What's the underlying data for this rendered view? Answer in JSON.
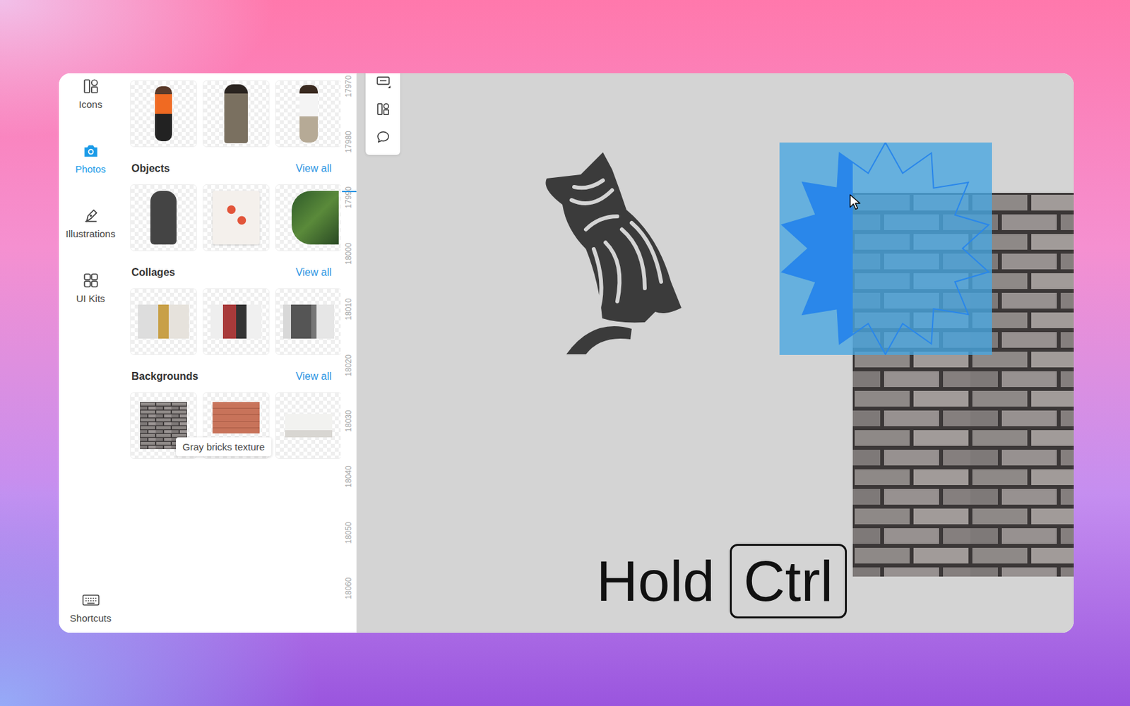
{
  "rail": [
    {
      "label": "Icons",
      "selected": false
    },
    {
      "label": "Photos",
      "selected": true
    },
    {
      "label": "Illustrations",
      "selected": false
    },
    {
      "label": "UI Kits",
      "selected": false
    }
  ],
  "shortcuts": {
    "label": "Shortcuts"
  },
  "sections": [
    {
      "title": "Objects",
      "link": "View all"
    },
    {
      "title": "Collages",
      "link": "View all"
    },
    {
      "title": "Backgrounds",
      "link": "View all"
    }
  ],
  "tooltip": "Gray bricks texture",
  "ruler": [
    "17970",
    "17980",
    "17990",
    "18000",
    "18010",
    "18020",
    "18030",
    "18040",
    "18050",
    "18060"
  ],
  "hint": {
    "text": "Hold",
    "key": "Ctrl"
  }
}
